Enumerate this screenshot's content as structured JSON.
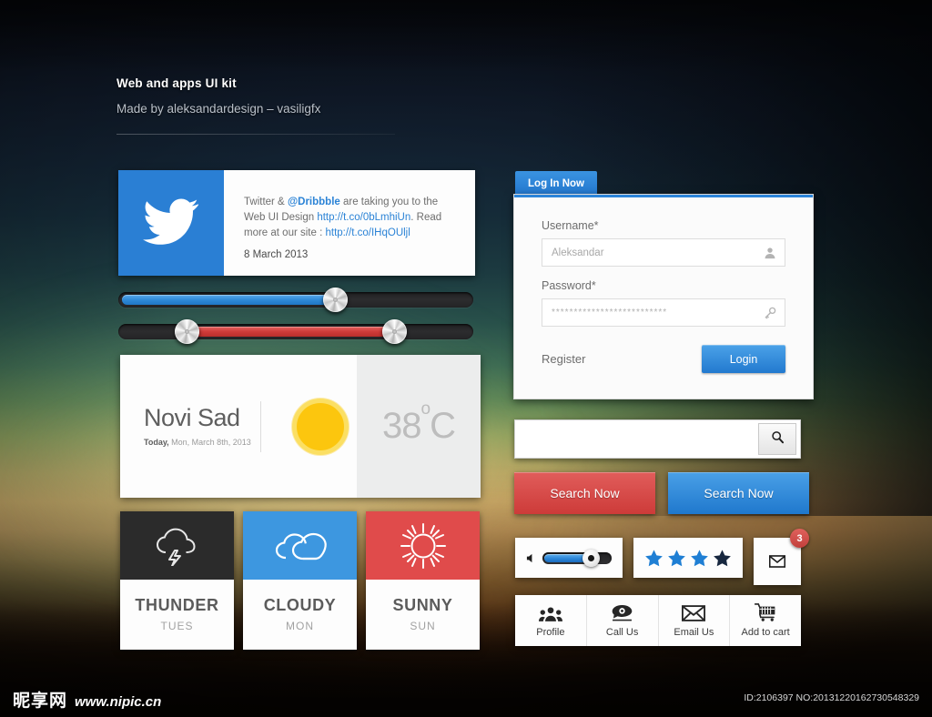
{
  "header": {
    "title": "Web and apps UI kit",
    "subtitle": "Made by aleksandardesign – vasiligfx"
  },
  "tweet_card": {
    "icon": "twitter-bird-icon",
    "text_before_mention": "Twitter & ",
    "mention": "@Dribbble",
    "text_mid": " are taking you to the Web UI Design ",
    "link1": "http://t.co/0bLmhiUn",
    "text_after": ". Read more at our site : ",
    "link2": "http://t.co/IHqOUljl",
    "date": "8 March 2013"
  },
  "sliders": [
    {
      "name": "blue-slider",
      "color": "#2f8ad8",
      "value_pct": 60,
      "handles": 1
    },
    {
      "name": "red-slider",
      "color": "#cf3b39",
      "low_pct": 17,
      "high_pct": 77,
      "handles": 2
    }
  ],
  "weather": {
    "city": "Novi Sad",
    "today_label": "Today,",
    "date": " Mon, March 8th, 2013",
    "icon": "sun-icon",
    "temperature": "38",
    "degree_symbol": "o",
    "unit": "C"
  },
  "forecast": [
    {
      "name": "THUNDER",
      "day": "TUES",
      "icon": "thunder-cloud-icon",
      "bg": "#2b2b2b"
    },
    {
      "name": "CLOUDY",
      "day": "MON",
      "icon": "cloud-icon",
      "bg": "#3d97e0"
    },
    {
      "name": "SUNNY",
      "day": "SUN",
      "icon": "sun-rays-icon",
      "bg": "#e04b4b"
    }
  ],
  "login": {
    "tab_label": "Log In Now",
    "username_label": "Username*",
    "username_value": "Aleksandar",
    "username_icon": "user-icon",
    "password_label": "Password*",
    "password_value": "**************************",
    "password_icon": "key-icon",
    "register_label": "Register",
    "login_button": "Login",
    "accent_color": "#2b84d9"
  },
  "search": {
    "placeholder": "",
    "value": "",
    "icon": "search-icon",
    "button_red": "Search Now",
    "button_blue": "Search Now",
    "red_color": "#cd3b39",
    "blue_color": "#1f78cd"
  },
  "widgets": {
    "volume": {
      "icon": "speaker-icon",
      "value_pct": 58
    },
    "rating": {
      "filled": 3,
      "total": 4,
      "filled_color": "#1f7fd4",
      "last_color": "#17273f"
    },
    "mail": {
      "icon": "envelope-icon",
      "badge_count": "3",
      "badge_color": "#c2403c"
    }
  },
  "toolbar": [
    {
      "label": "Profile",
      "icon": "people-icon"
    },
    {
      "label": "Call Us",
      "icon": "telephone-icon"
    },
    {
      "label": "Email Us",
      "icon": "envelope-icon"
    },
    {
      "label": "Add to cart",
      "icon": "shopping-cart-icon"
    }
  ],
  "footer": {
    "watermark_cn": "昵享网",
    "watermark_url": "www.nipic.cn",
    "id_text": "ID:2106397 NO:20131220162730548329"
  }
}
